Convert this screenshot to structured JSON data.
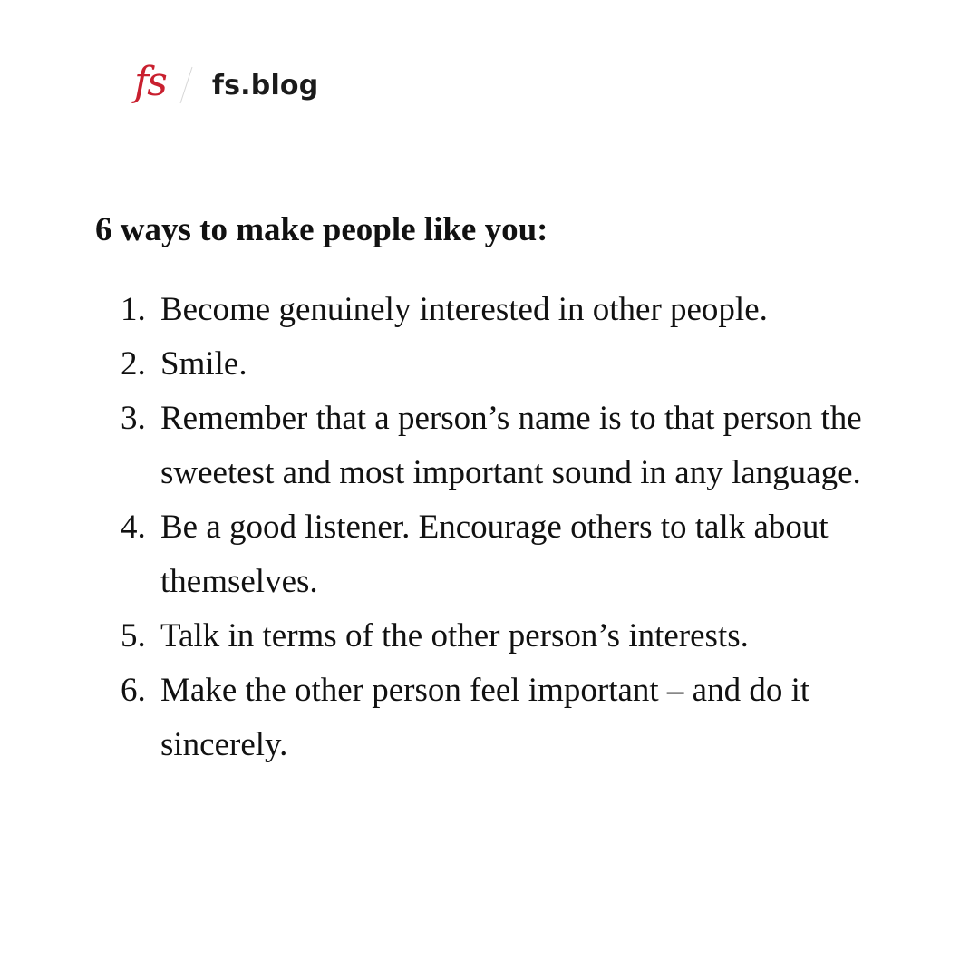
{
  "brand": {
    "logo_text": "fs",
    "site_name": "fs.blog",
    "accent_color": "#c9202f"
  },
  "content": {
    "heading": "6 ways to make people like you:",
    "items": [
      {
        "number": "1.",
        "text": "Become genuinely interested in other people."
      },
      {
        "number": "2.",
        "text": "Smile."
      },
      {
        "number": "3.",
        "text": "Remember that a person’s name is to that person the sweetest and most important sound in any language."
      },
      {
        "number": "4.",
        "text": "Be a good listener. Encourage others to talk about themselves."
      },
      {
        "number": "5.",
        "text": "Talk in terms of the other person’s interests."
      },
      {
        "number": "6.",
        "text": "Make the other person feel important – and do it sincerely."
      }
    ]
  }
}
